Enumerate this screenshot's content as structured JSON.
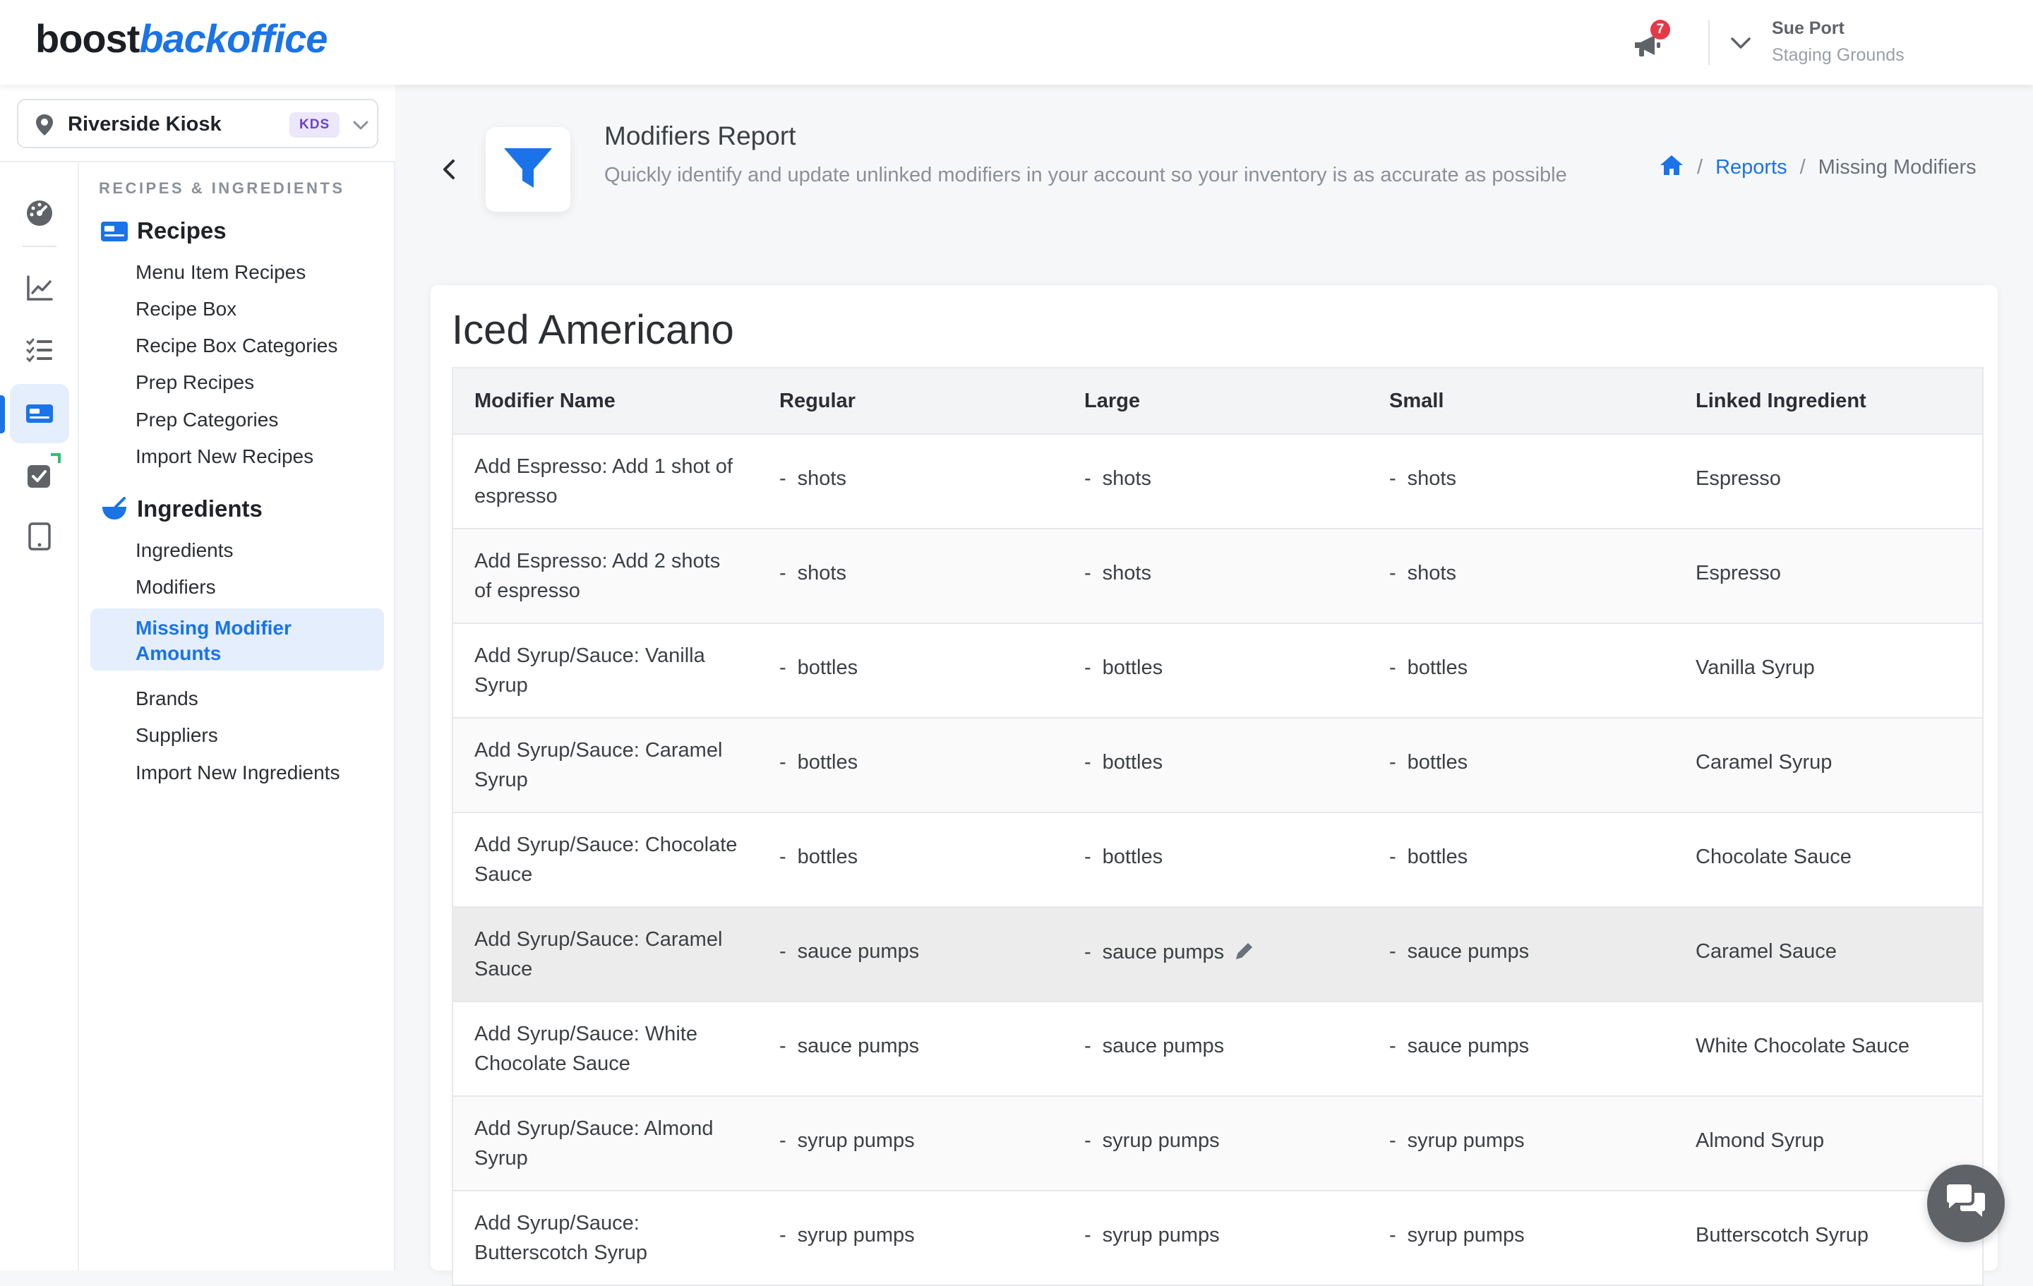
{
  "brand": {
    "logo_part1": "boost",
    "logo_part2": "backoffice",
    "accent": "#1a73e8"
  },
  "header": {
    "notifications_count": "7",
    "user_name": "Sue Port",
    "user_org": "Staging Grounds"
  },
  "location": {
    "name": "Riverside Kiosk",
    "badge": "KDS"
  },
  "rail": {
    "icons": [
      "dashboard-icon",
      "chart-icon",
      "checklist-icon",
      "recipes-card-icon",
      "tasks-check-icon",
      "tablet-icon"
    ],
    "active_index": 3
  },
  "submenu": {
    "section_title": "RECIPES & INGREDIENTS",
    "groups": [
      {
        "title": "Recipes",
        "icon": "recipes-card-icon",
        "items": [
          "Menu Item Recipes",
          "Recipe Box",
          "Recipe Box Categories",
          "Prep Recipes",
          "Prep Categories",
          "Import New Recipes"
        ]
      },
      {
        "title": "Ingredients",
        "icon": "mortar-icon",
        "items": [
          "Ingredients",
          "Modifiers",
          "Missing Modifier Amounts",
          "Brands",
          "Suppliers",
          "Import New Ingredients"
        ],
        "active_item": "Missing Modifier Amounts"
      }
    ]
  },
  "page": {
    "title": "Modifiers Report",
    "subtitle": "Quickly identify and update unlinked modifiers in your account so your inventory is as accurate as possible",
    "breadcrumb": [
      "Reports",
      "Missing Modifiers"
    ]
  },
  "report": {
    "item_title": "Iced Americano",
    "columns": [
      "Modifier Name",
      "Regular",
      "Large",
      "Small",
      "Linked Ingredient"
    ],
    "rows": [
      {
        "name": "Add Espresso: Add 1 shot of espresso",
        "regular": "shots",
        "large": "shots",
        "small": "shots",
        "linked": "Espresso"
      },
      {
        "name": "Add Espresso: Add 2 shots of espresso",
        "regular": "shots",
        "large": "shots",
        "small": "shots",
        "linked": "Espresso"
      },
      {
        "name": "Add Syrup/Sauce: Vanilla Syrup",
        "regular": "bottles",
        "large": "bottles",
        "small": "bottles",
        "linked": "Vanilla Syrup"
      },
      {
        "name": "Add Syrup/Sauce: Caramel Syrup",
        "regular": "bottles",
        "large": "bottles",
        "small": "bottles",
        "linked": "Caramel Syrup"
      },
      {
        "name": "Add Syrup/Sauce: Chocolate Sauce",
        "regular": "bottles",
        "large": "bottles",
        "small": "bottles",
        "linked": "Chocolate Sauce"
      },
      {
        "name": "Add Syrup/Sauce: Caramel Sauce",
        "regular": "sauce pumps",
        "large": "sauce pumps",
        "small": "sauce pumps",
        "linked": "Caramel Sauce"
      },
      {
        "name": "Add Syrup/Sauce: White Chocolate Sauce",
        "regular": "sauce pumps",
        "large": "sauce pumps",
        "small": "sauce pumps",
        "linked": "White Chocolate Sauce"
      },
      {
        "name": "Add Syrup/Sauce: Almond Syrup",
        "regular": "syrup pumps",
        "large": "syrup pumps",
        "small": "syrup pumps",
        "linked": "Almond Syrup"
      },
      {
        "name": "Add Syrup/Sauce: Butterscotch Syrup",
        "regular": "syrup pumps",
        "large": "syrup pumps",
        "small": "syrup pumps",
        "linked": "Butterscotch Syrup"
      }
    ],
    "value_prefix": "-",
    "hovered_row_index": 5
  }
}
